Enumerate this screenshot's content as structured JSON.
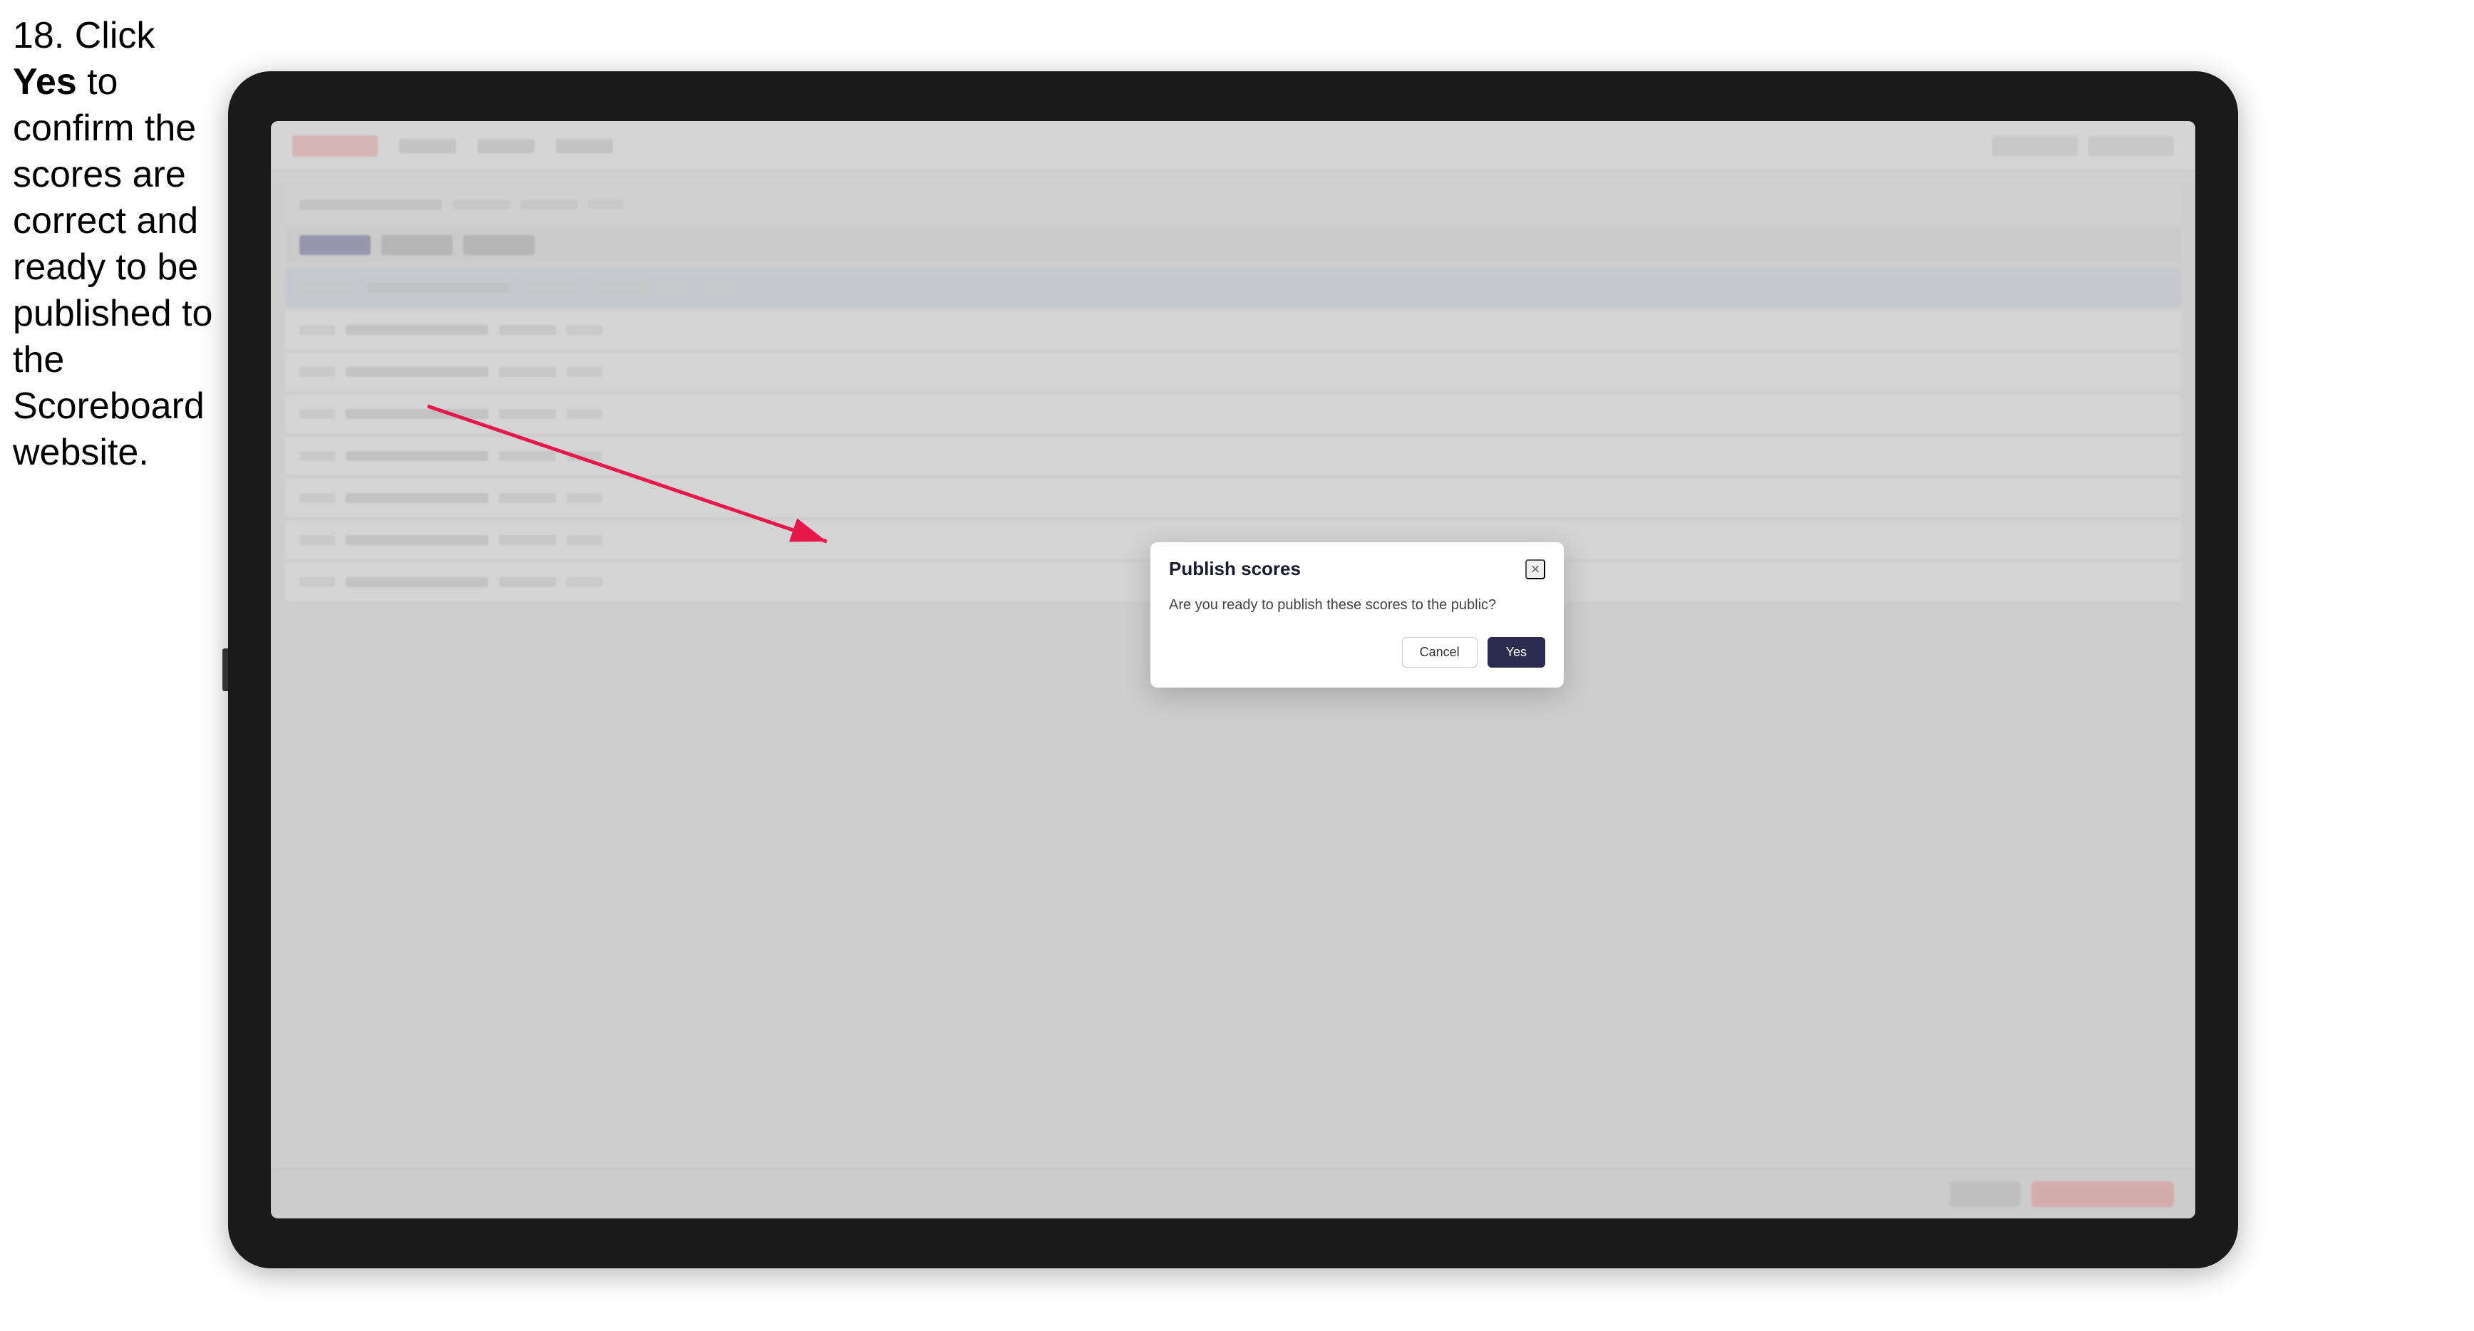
{
  "instruction": {
    "step_number": "18.",
    "text_parts": [
      {
        "text": "Click ",
        "bold": false
      },
      {
        "text": "Yes",
        "bold": true
      },
      {
        "text": " to confirm the scores are correct and ready to be published to the Scoreboard website.",
        "bold": false
      }
    ],
    "full_text": "18. Click Yes to confirm the scores are correct and ready to be published to the Scoreboard website."
  },
  "dialog": {
    "title": "Publish scores",
    "message": "Are you ready to publish these scores to the public?",
    "cancel_label": "Cancel",
    "yes_label": "Yes",
    "close_icon": "×"
  },
  "app": {
    "header": {
      "logo_placeholder": "Logo"
    }
  }
}
